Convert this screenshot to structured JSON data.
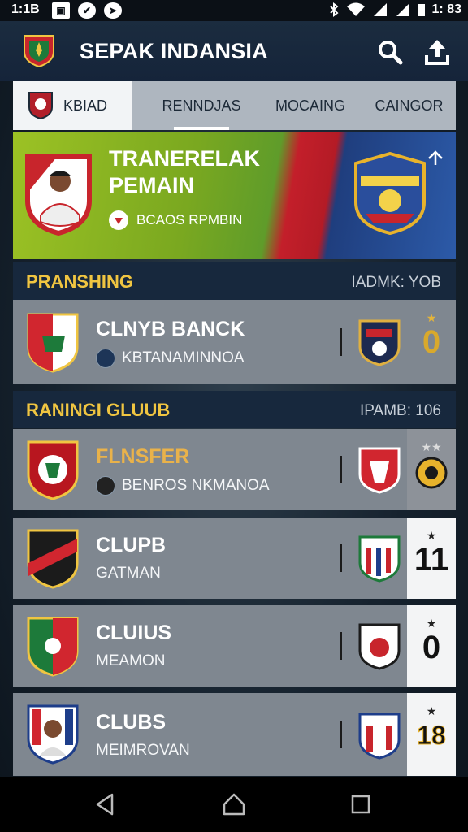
{
  "status_bar": {
    "time": "1:1B",
    "battery_time": "1: 83"
  },
  "app_bar": {
    "title": "SEPAK INDANSIA"
  },
  "tabs": [
    "KBIAD",
    "RENNDJAS",
    "MOCAING",
    "CAINGOR"
  ],
  "banner": {
    "title": "TRANERELAK PEMAIN",
    "subtitle": "BCAOS RPMBIN"
  },
  "section_1": {
    "label": "PRANSHING",
    "right": "IADMK: YOB"
  },
  "section_2": {
    "label": "RANINGI GLUUB",
    "right": "IPAMB: 106"
  },
  "cards": [
    {
      "name": "CLNYB BANCK",
      "sub": "KBTANAMINNOA",
      "score": "0",
      "score_style": "gold-plain"
    },
    {
      "name": "FLNSFER",
      "sub": "BENROS NKMANOA",
      "score": "",
      "score_style": "badge"
    },
    {
      "name": "CLUPB",
      "sub": "GATMAN",
      "score": "11",
      "score_style": "light"
    },
    {
      "name": "CLUIUS",
      "sub": "MEAMON",
      "score": "0",
      "score_style": "light"
    },
    {
      "name": "CLUBS",
      "sub": "MEIMROVAN",
      "score": "18",
      "score_style": "light-gold"
    }
  ],
  "colors": {
    "accent": "#f0c541",
    "appbar": "#1b2c3f",
    "card": "#7f8790",
    "header": "#17283d"
  }
}
